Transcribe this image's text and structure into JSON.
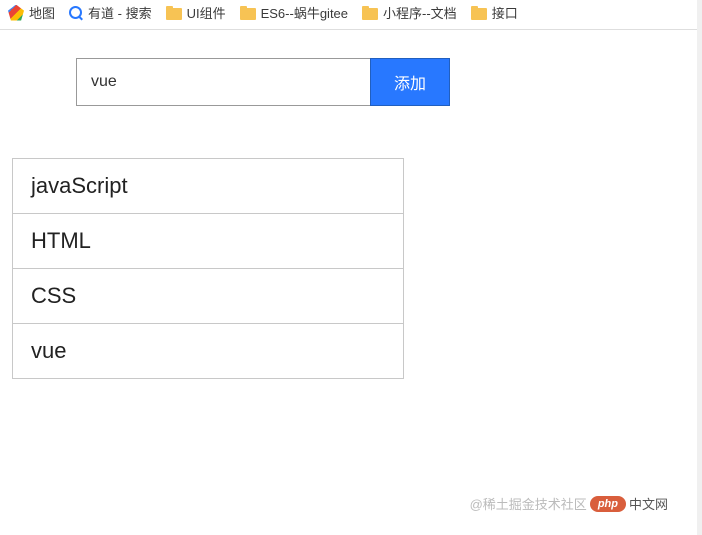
{
  "bookmarks": [
    {
      "icon": "maps",
      "label": "地图"
    },
    {
      "icon": "search",
      "label": "有道 - 搜索"
    },
    {
      "icon": "folder",
      "label": "UI组件"
    },
    {
      "icon": "folder",
      "label": "ES6--蜗牛gitee"
    },
    {
      "icon": "folder",
      "label": "小程序--文档"
    },
    {
      "icon": "folder",
      "label": "接口"
    }
  ],
  "form": {
    "input_value": "vue",
    "add_button_label": "添加"
  },
  "list_items": [
    "javaScript",
    "HTML",
    "CSS",
    "vue"
  ],
  "watermark": {
    "prefix": "@稀土掘金技术社区",
    "badge": "php",
    "suffix": "中文网"
  }
}
